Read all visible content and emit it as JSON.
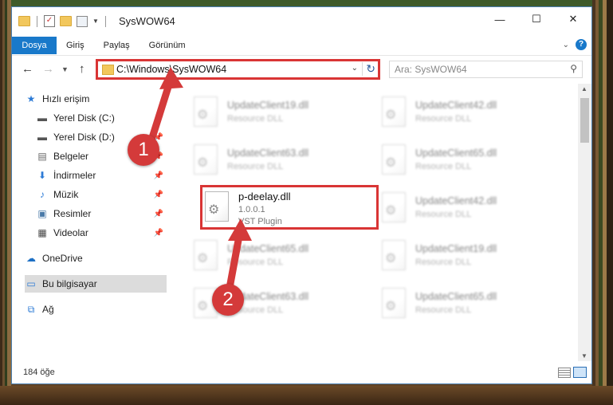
{
  "window": {
    "title": "SysWOW64",
    "controls": {
      "minimize": "—",
      "maximize": "☐",
      "close": "✕"
    }
  },
  "ribbon": {
    "tabs": [
      "Dosya",
      "Giriş",
      "Paylaş",
      "Görünüm"
    ],
    "accent_color": "#1979ca"
  },
  "navigation": {
    "address": "C:\\Windows\\SysWOW64",
    "search_placeholder": "Ara: SysWOW64"
  },
  "sidebar": {
    "items": [
      {
        "label": "Hızlı erişim",
        "icon": "star-icon"
      },
      {
        "label": "Yerel Disk (C:)",
        "icon": "drive-icon"
      },
      {
        "label": "Yerel Disk (D:)",
        "icon": "drive-icon"
      },
      {
        "label": "Belgeler",
        "icon": "document-icon"
      },
      {
        "label": "İndirmeler",
        "icon": "download-icon"
      },
      {
        "label": "Müzik",
        "icon": "music-icon"
      },
      {
        "label": "Resimler",
        "icon": "pictures-icon"
      },
      {
        "label": "Videolar",
        "icon": "video-icon"
      },
      {
        "label": "OneDrive",
        "icon": "cloud-icon"
      },
      {
        "label": "Bu bilgisayar",
        "icon": "computer-icon"
      },
      {
        "label": "Ağ",
        "icon": "network-icon"
      }
    ]
  },
  "files": [
    {
      "name": "UpdateClient19.dll",
      "sub": "Resource DLL"
    },
    {
      "name": "UpdateClient42.dll",
      "sub": "Resource DLL"
    },
    {
      "name": "UpdateClient63.dll",
      "sub": "Resource DLL"
    },
    {
      "name": "UpdateClient65.dll",
      "sub": "Resource DLL"
    },
    {
      "name": "p-deelay.dll",
      "version": "1.0.0.1",
      "sub": "VST Plugin"
    },
    {
      "name": "UpdateClient42.dll",
      "sub": "Resource DLL"
    },
    {
      "name": "UpdateClient65.dll",
      "sub": "Resource DLL"
    },
    {
      "name": "UpdateClient19.dll",
      "sub": "Resource DLL"
    },
    {
      "name": "UpdateClient63.dll",
      "sub": "Resource DLL"
    },
    {
      "name": "UpdateClient65.dll",
      "sub": "Resource DLL"
    }
  ],
  "status": {
    "item_count": "184 öğe"
  },
  "annotations": {
    "step1": "1",
    "step2": "2",
    "highlight_color": "#d93535"
  }
}
